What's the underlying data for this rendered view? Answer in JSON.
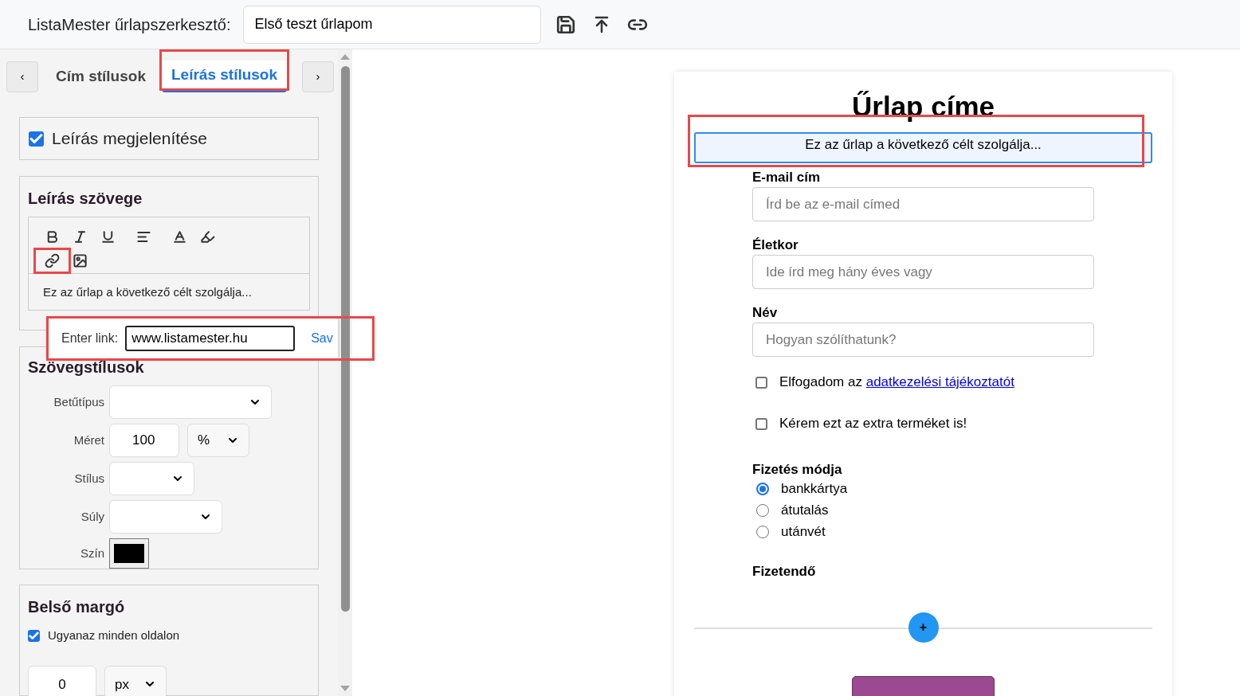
{
  "header": {
    "title": "ListaMester űrlapszerkesztő:",
    "form_name": "Első teszt űrlapom"
  },
  "tab_bar": {
    "prev": "‹",
    "next": "›",
    "tabs": [
      {
        "label": "Cím stílusok",
        "selected": false,
        "highlighted": false
      },
      {
        "label": "Leírás stílusok",
        "selected": true,
        "highlighted": true
      }
    ]
  },
  "display_section": {
    "label": "Leírás megjelenítése",
    "checked": true
  },
  "text_section": {
    "title": "Leírás szövege",
    "tools": [
      {
        "kind": "bold",
        "highlighted": false
      },
      {
        "kind": "italic",
        "highlighted": false
      },
      {
        "kind": "underline",
        "highlighted": false
      },
      {
        "kind": "align",
        "highlighted": false
      },
      {
        "kind": "color",
        "highlighted": false
      },
      {
        "kind": "background",
        "highlighted": false
      },
      {
        "kind": "link",
        "highlighted": true
      },
      {
        "kind": "image",
        "highlighted": false
      }
    ],
    "content": "Ez az űrlap a következő célt szolgálja...",
    "link_popup": {
      "label": "Enter link:",
      "value": "www.listamester.hu",
      "save": "Sav",
      "highlighted": true
    }
  },
  "style_section": {
    "title": "Szövegstílusok",
    "rows": [
      {
        "kind": "font",
        "label": "Betűtípus"
      },
      {
        "kind": "size",
        "label": "Méret",
        "value": "100",
        "unit": "%"
      },
      {
        "kind": "style",
        "label": "Stílus"
      },
      {
        "kind": "weight",
        "label": "Súly"
      },
      {
        "kind": "color",
        "label": "Szín",
        "color": "#000000"
      }
    ]
  },
  "padding_section": {
    "title": "Belső margó",
    "same_all": {
      "label": "Ugyanaz minden oldalon",
      "checked": true
    },
    "value": "0",
    "unit": "px"
  },
  "form": {
    "title": "Űrlap címe",
    "description": {
      "text": "Ez az űrlap a következő célt szolgálja...",
      "highlighted": true
    },
    "fields": [
      {
        "kind": "text",
        "label": "E-mail cím",
        "placeholder": "Írd be az e-mail címed"
      },
      {
        "kind": "text",
        "label": "Életkor",
        "placeholder": "Ide írd meg hány éves vagy"
      },
      {
        "kind": "text",
        "label": "Név",
        "placeholder": "Hogyan szólíthatunk?"
      },
      {
        "kind": "checkbox",
        "text": "Elfogadom az",
        "link": "adatkezelési tájékoztatót",
        "checked": false
      },
      {
        "kind": "checkbox",
        "text": "Kérem ezt az extra terméket is!",
        "checked": false
      },
      {
        "kind": "radio",
        "label": "Fizetés módja",
        "options": [
          {
            "label": "bankkártya",
            "selected": true
          },
          {
            "label": "átutalás",
            "selected": false
          },
          {
            "label": "utánvét",
            "selected": false
          }
        ]
      },
      {
        "kind": "total",
        "label": "Fizetendő"
      }
    ],
    "add_button": "+"
  }
}
